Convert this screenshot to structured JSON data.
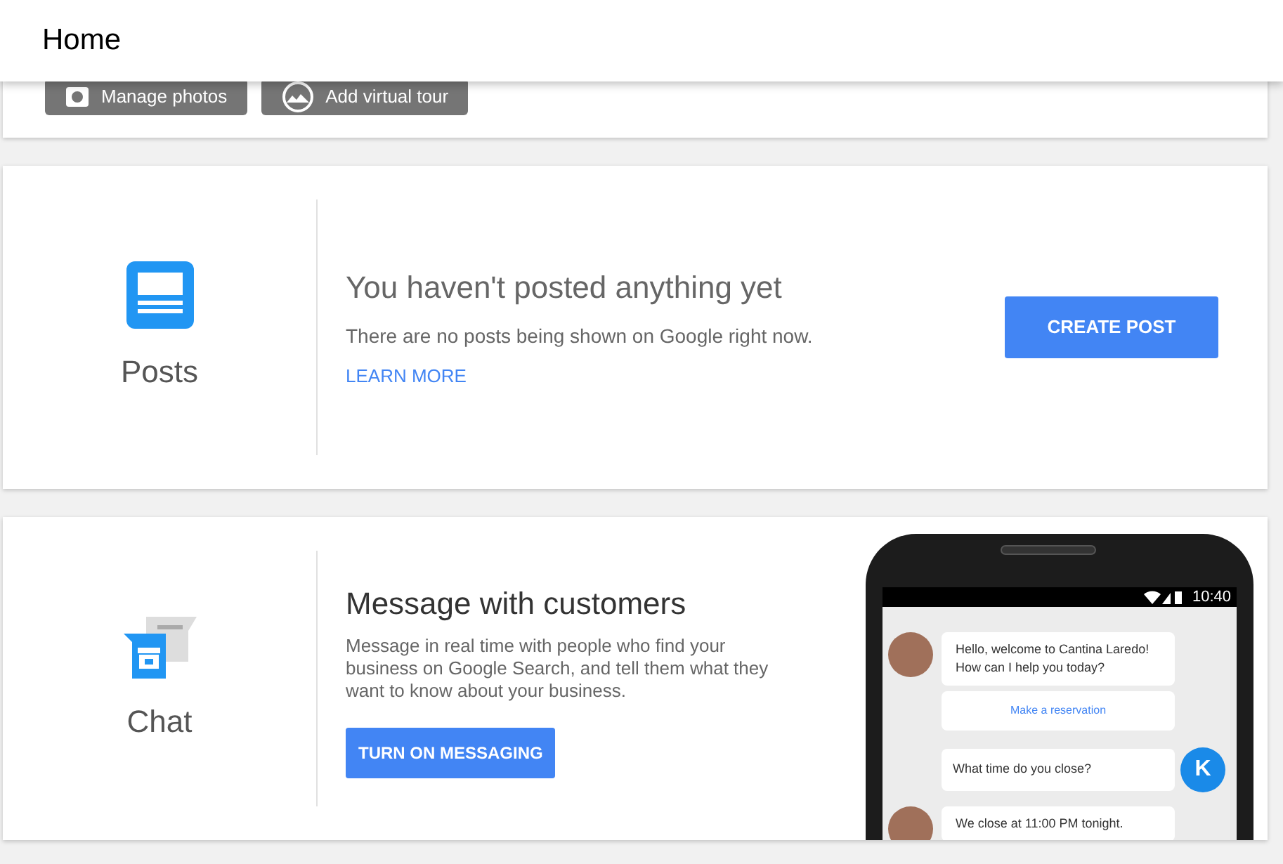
{
  "header": {
    "title": "Home"
  },
  "photos_card": {
    "buttons": [
      {
        "label": "Manage photos",
        "kind": "camera"
      },
      {
        "label": "Add virtual tour",
        "kind": "tour"
      }
    ]
  },
  "posts_card": {
    "section": "Posts",
    "title": "You haven't posted anything yet",
    "description": "There are no posts being shown on Google right now.",
    "link": "LEARN MORE",
    "button": "CREATE POST"
  },
  "chat_card": {
    "section": "Chat",
    "title": "Message with customers",
    "description": "Message in real time with people who find your business on Google Search, and tell them what they want to know about your business.",
    "button": "TURN ON MESSAGING",
    "phone": {
      "time": "10:40",
      "messages": [
        {
          "kind": "incoming",
          "text": "Hello, welcome to Cantina Laredo! How can I help you today?"
        },
        {
          "kind": "action",
          "text": "Make a reservation"
        },
        {
          "kind": "outgoing",
          "text": "What time do you close?",
          "avatar": "K"
        },
        {
          "kind": "incoming",
          "text": "We close at 11:00 PM tonight."
        }
      ]
    }
  }
}
